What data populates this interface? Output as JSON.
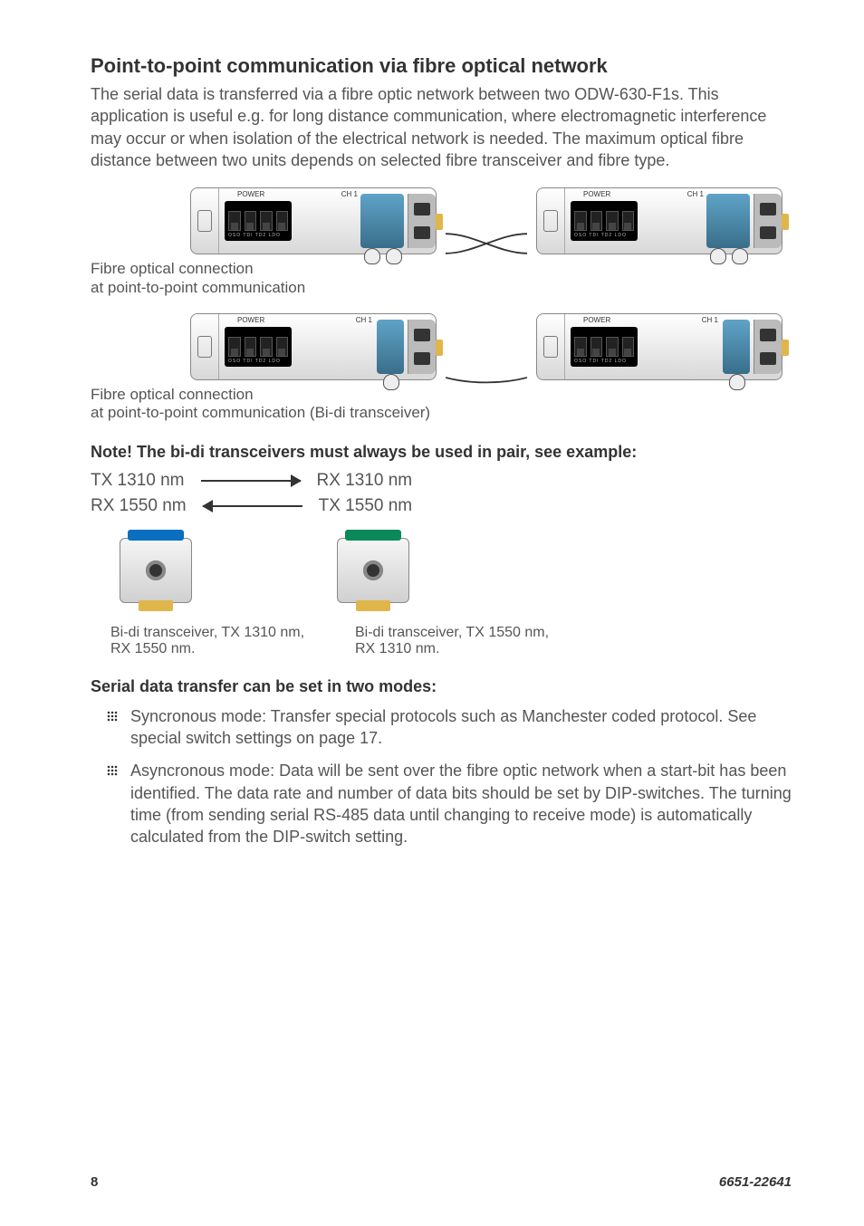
{
  "title": "Point-to-point communication via fibre optical network",
  "intro": "The serial data is transferred via a fibre optic network between two ODW-630-F1s. This application is useful e.g. for long distance communication, where electromagnetic interference may occur or when isolation of the electrical network is needed. The maximum optical fibre distance between two units depends on selected fibre transceiver and fibre type.",
  "device_labels": {
    "power": "POWER",
    "ch1": "CH 1"
  },
  "caption1_line1": "Fibre optical connection",
  "caption1_line2": "at point-to-point communication",
  "caption2_line1": "Fibre optical connection",
  "caption2_line2": "at point-to-point communication (Bi-di transceiver)",
  "note_heading": "Note! The bi-di transceivers must always be used in pair, see example:",
  "pair": {
    "tx_a": "TX 1310 nm",
    "rx_a": "RX 1310 nm",
    "rx_b": "RX 1550 nm",
    "tx_b": "TX 1550 nm"
  },
  "trans1_cap": "Bi-di transceiver, TX 1310 nm, RX 1550 nm.",
  "trans2_cap": "Bi-di transceiver, TX 1550 nm, RX 1310 nm.",
  "modes_heading": "Serial data transfer can be set in two modes:",
  "mode1": "Syncronous mode: Transfer special protocols such as Manchester coded protocol. See special switch settings on page 17.",
  "mode2": "Asyncronous mode: Data will be sent over the fibre optic network when a start-bit has been identified. The data rate and number of data bits should be set by DIP-switches. The turning time (from sending serial RS-485 data until changing to receive mode) is automatically calculated from the DIP-switch setting.",
  "page_number": "8",
  "doc_id": "6651-22641"
}
